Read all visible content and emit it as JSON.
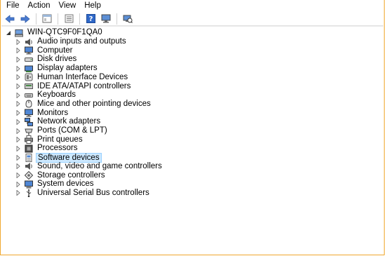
{
  "menu": [
    "File",
    "Action",
    "View",
    "Help"
  ],
  "toolbar": {
    "icons": [
      "back-arrow-icon",
      "forward-arrow-icon",
      "device-manager-icon",
      "properties-icon",
      "help-icon",
      "scan-hardware-icon"
    ]
  },
  "tree": {
    "root": {
      "label": "WIN-QTC9F0F1QA0",
      "expanded": true
    },
    "items": [
      {
        "label": "Audio inputs and outputs",
        "icon": "speaker-icon"
      },
      {
        "label": "Computer",
        "icon": "monitor-icon"
      },
      {
        "label": "Disk drives",
        "icon": "disk-icon"
      },
      {
        "label": "Display adapters",
        "icon": "display-adapter-icon"
      },
      {
        "label": "Human Interface Devices",
        "icon": "hid-icon"
      },
      {
        "label": "IDE ATA/ATAPI controllers",
        "icon": "ide-icon"
      },
      {
        "label": "Keyboards",
        "icon": "keyboard-icon"
      },
      {
        "label": "Mice and other pointing devices",
        "icon": "mouse-icon"
      },
      {
        "label": "Monitors",
        "icon": "monitor-icon"
      },
      {
        "label": "Network adapters",
        "icon": "network-icon"
      },
      {
        "label": "Ports (COM & LPT)",
        "icon": "port-icon"
      },
      {
        "label": "Print queues",
        "icon": "printer-icon"
      },
      {
        "label": "Processors",
        "icon": "cpu-icon"
      },
      {
        "label": "Software devices",
        "icon": "software-device-icon",
        "selected": true
      },
      {
        "label": "Sound, video and game controllers",
        "icon": "speaker-icon"
      },
      {
        "label": "Storage controllers",
        "icon": "storage-icon"
      },
      {
        "label": "System devices",
        "icon": "system-icon"
      },
      {
        "label": "Universal Serial Bus controllers",
        "icon": "usb-icon"
      }
    ]
  },
  "colors": {
    "window_border": "#f0a830",
    "selection_fill": "#cce8ff",
    "selection_border": "#99d1ff"
  }
}
